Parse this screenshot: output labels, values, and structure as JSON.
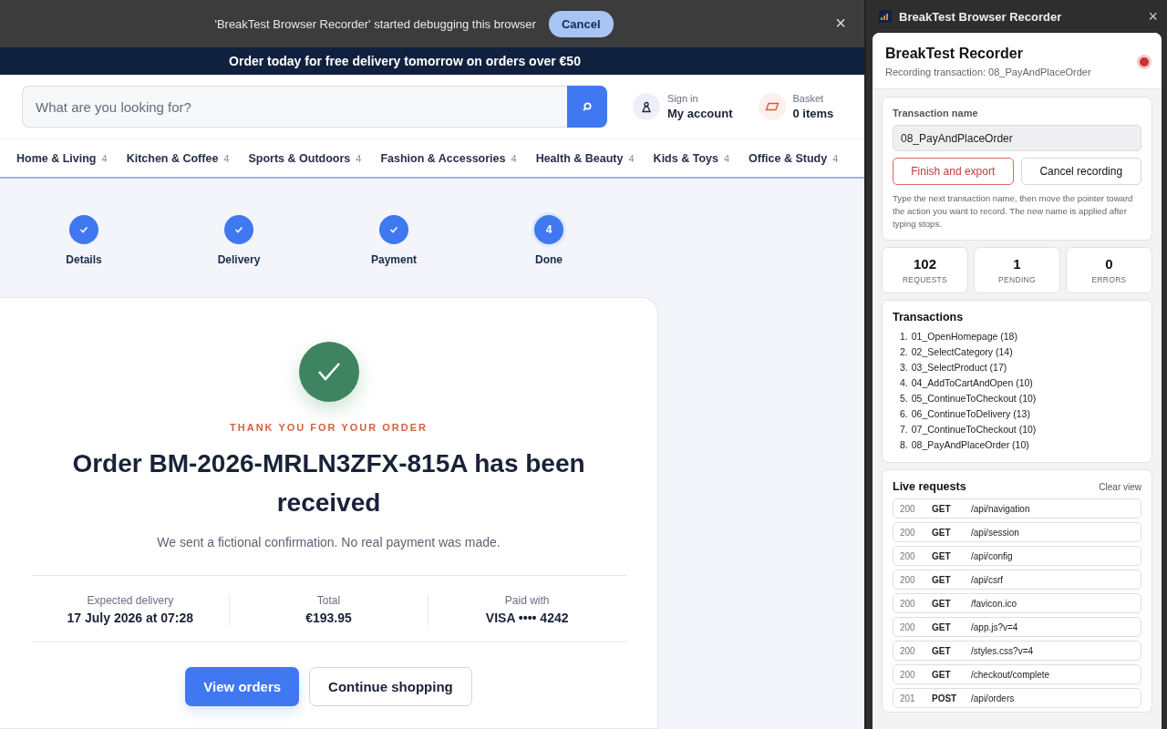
{
  "debug_bar": {
    "message": "'BreakTest Browser Recorder' started debugging this browser",
    "cancel_button": "Cancel",
    "close": "×"
  },
  "promo_bar": {
    "text": "Order today for free delivery tomorrow on orders over €50"
  },
  "header": {
    "search": {
      "placeholder": "What are you looking for?"
    },
    "account": {
      "caption": "Sign in",
      "label": "My account"
    },
    "basket": {
      "caption": "Basket",
      "label": "0 items"
    }
  },
  "categories": [
    {
      "label": "Home & Living",
      "count": "4"
    },
    {
      "label": "Kitchen & Coffee",
      "count": "4"
    },
    {
      "label": "Sports & Outdoors",
      "count": "4"
    },
    {
      "label": "Fashion & Accessories",
      "count": "4"
    },
    {
      "label": "Health & Beauty",
      "count": "4"
    },
    {
      "label": "Kids & Toys",
      "count": "4"
    },
    {
      "label": "Office & Study",
      "count": "4"
    }
  ],
  "steps": [
    {
      "label": "Details",
      "completed": true
    },
    {
      "label": "Delivery",
      "completed": true
    },
    {
      "label": "Payment",
      "completed": true
    },
    {
      "label": "Done",
      "completed": false,
      "number": "4"
    }
  ],
  "confirmation": {
    "eyebrow": "THANK YOU FOR YOUR ORDER",
    "title": "Order BM-2026-MRLN3ZFX-815A has been received",
    "subtitle": "We sent a fictional confirmation. No real payment was made.",
    "facts": [
      {
        "label": "Expected delivery",
        "value": "17 July 2026 at 07:28"
      },
      {
        "label": "Total",
        "value": "€193.95"
      },
      {
        "label": "Paid with",
        "value": "VISA •••• 4242"
      }
    ],
    "buttons": [
      {
        "label": "View orders",
        "kind": "primary"
      },
      {
        "label": "Continue shopping",
        "kind": "secondary"
      }
    ]
  },
  "recorder": {
    "window_title": "BreakTest Browser Recorder",
    "close": "×",
    "title": "BreakTest Recorder",
    "subtitle": "Recording transaction: 08_PayAndPlaceOrder",
    "recording": true,
    "transaction_name": {
      "label": "Transaction name",
      "value": "08_PayAndPlaceOrder"
    },
    "buttons": [
      {
        "label": "Finish and export",
        "kind": "danger"
      },
      {
        "label": "Cancel recording",
        "kind": "plain"
      }
    ],
    "hint": "Type the next transaction name, then move the pointer toward the action you want to record. The new name is applied after typing stops.",
    "stats": [
      {
        "value": "102",
        "label": "REQUESTS"
      },
      {
        "value": "1",
        "label": "PENDING"
      },
      {
        "value": "0",
        "label": "ERRORS"
      }
    ],
    "transactions_title": "Transactions",
    "transactions": [
      {
        "number": "1.",
        "name": "01_OpenHomepage (18)"
      },
      {
        "number": "2.",
        "name": "02_SelectCategory (14)"
      },
      {
        "number": "3.",
        "name": "03_SelectProduct (17)"
      },
      {
        "number": "4.",
        "name": "04_AddToCartAndOpen (10)"
      },
      {
        "number": "5.",
        "name": "05_ContinueToCheckout (10)"
      },
      {
        "number": "6.",
        "name": "06_ContinueToDelivery (13)"
      },
      {
        "number": "7.",
        "name": "07_ContinueToCheckout (10)"
      },
      {
        "number": "8.",
        "name": "08_PayAndPlaceOrder (10)"
      }
    ],
    "live_title": "Live requests",
    "clear_view": "Clear view",
    "requests": [
      {
        "status": "200",
        "method": "GET",
        "path": "/api/navigation"
      },
      {
        "status": "200",
        "method": "GET",
        "path": "/api/session"
      },
      {
        "status": "200",
        "method": "GET",
        "path": "/api/config"
      },
      {
        "status": "200",
        "method": "GET",
        "path": "/api/csrf"
      },
      {
        "status": "200",
        "method": "GET",
        "path": "/favicon.ico"
      },
      {
        "status": "200",
        "method": "GET",
        "path": "/app.js?v=4"
      },
      {
        "status": "200",
        "method": "GET",
        "path": "/styles.css?v=4"
      },
      {
        "status": "200",
        "method": "GET",
        "path": "/checkout/complete"
      },
      {
        "status": "201",
        "method": "POST",
        "path": "/api/orders"
      }
    ]
  }
}
